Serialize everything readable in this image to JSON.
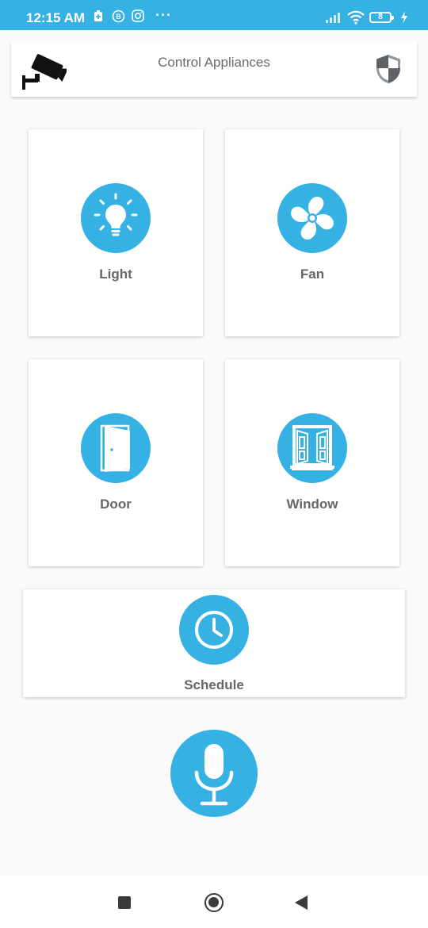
{
  "status_bar": {
    "time": "12:15 AM",
    "battery": "8",
    "more": "···",
    "icons": [
      "battery-saver-icon",
      "b-app-icon",
      "instagram-icon",
      "signal-icon",
      "wifi-icon",
      "charging-icon"
    ]
  },
  "header": {
    "title": "Control Appliances",
    "left_icon": "security-camera-icon",
    "right_icon": "shield-icon"
  },
  "tiles": [
    {
      "label": "Light",
      "icon": "light-bulb-icon"
    },
    {
      "label": "Fan",
      "icon": "fan-icon"
    },
    {
      "label": "Door",
      "icon": "door-icon"
    },
    {
      "label": "Window",
      "icon": "window-icon"
    },
    {
      "label": "Schedule",
      "icon": "clock-icon"
    }
  ],
  "mic": {
    "icon": "microphone-icon"
  },
  "nav": {
    "icons": [
      "recents-icon",
      "home-icon",
      "back-icon"
    ]
  },
  "colors": {
    "accent": "#35b1e4",
    "status_bar": "#35b1e4",
    "label_text": "#666666",
    "background": "#fafafa"
  }
}
